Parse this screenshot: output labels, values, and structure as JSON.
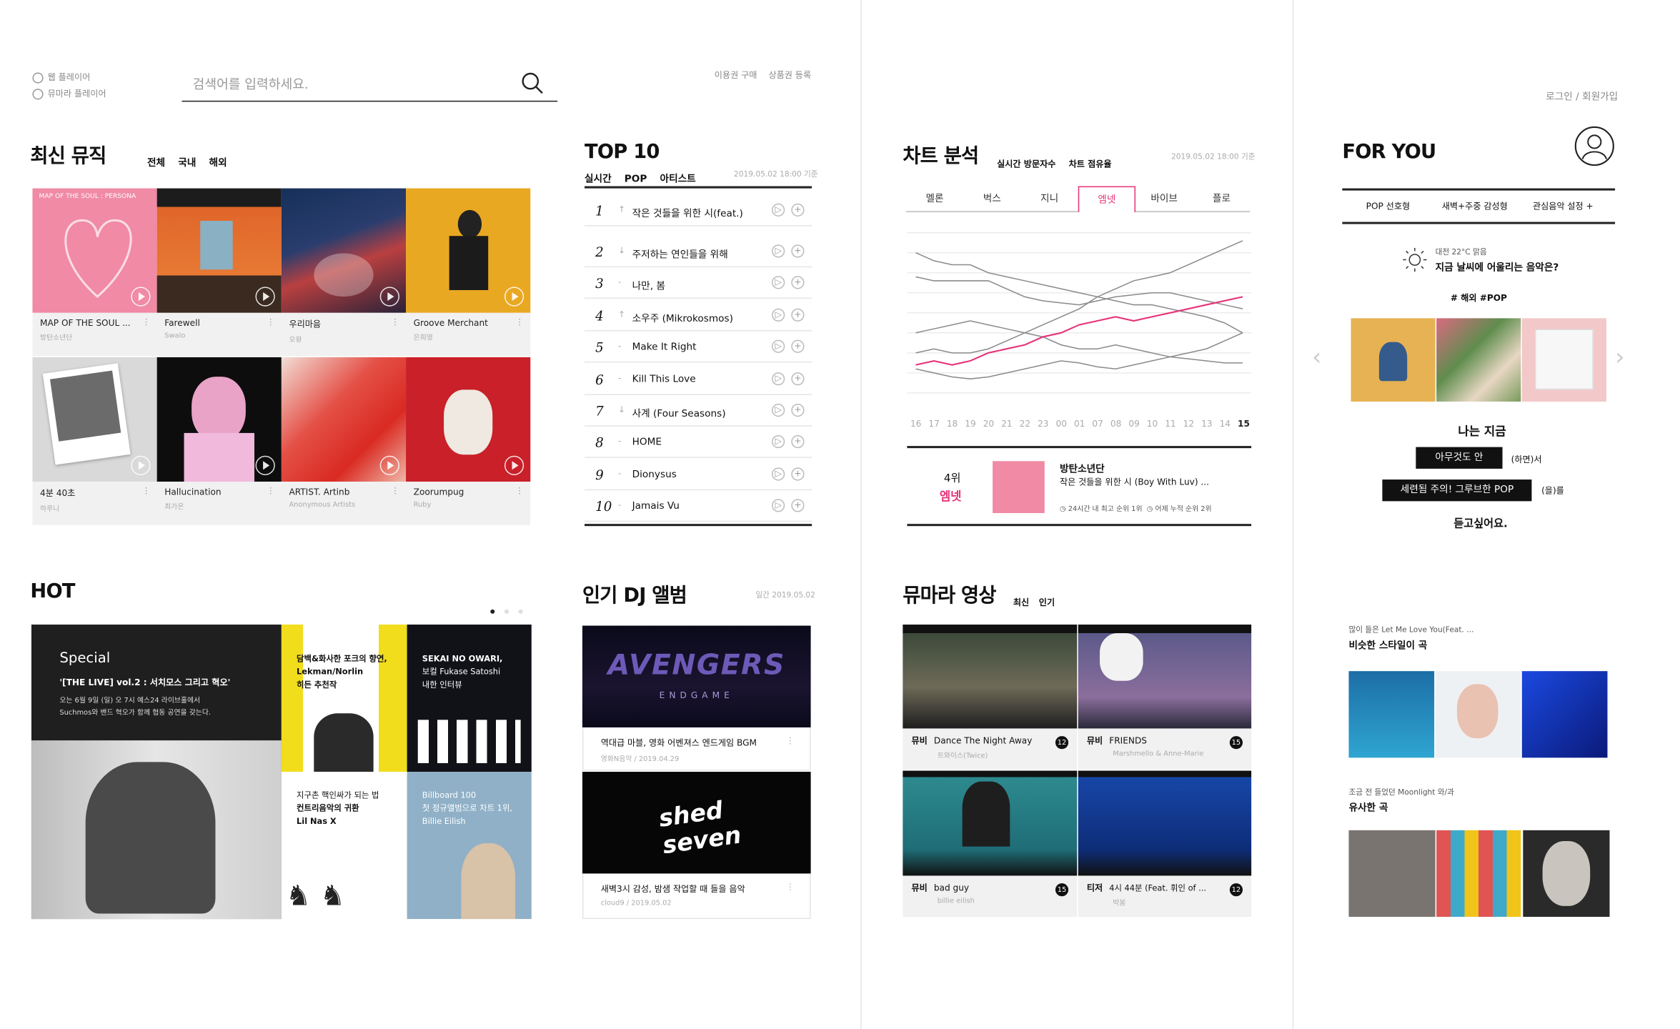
{
  "topbar": {
    "web_player": "웹 플레이어",
    "mumara_player": "뮤마라 플레이어",
    "search_placeholder": "검색어를 입력하세요.",
    "buy_pass": "이용권 구매",
    "gift_card": "상품권 등록",
    "login": "로그인 / 회원가입"
  },
  "latest": {
    "title": "최신 뮤직",
    "tabs": [
      "전체",
      "국내",
      "해외"
    ],
    "albums": [
      {
        "title": "MAP OF THE SOUL ...",
        "artist": "방탄소년단",
        "cover_text": "MAP OF THE SOUL : PERSONA"
      },
      {
        "title": "Farewell",
        "artist": "Swalo"
      },
      {
        "title": "우리마음",
        "artist": "오왕"
      },
      {
        "title": "Groove Merchant",
        "artist": "은희영"
      },
      {
        "title": "4분 40초",
        "artist": "하루니"
      },
      {
        "title": "Hallucination",
        "artist": "최가온"
      },
      {
        "title": "ARTIST. Artinb",
        "artist": "Anonymous Artists"
      },
      {
        "title": "Zoorumpug",
        "artist": "Ruby"
      }
    ]
  },
  "top10": {
    "title": "TOP 10",
    "tabs": [
      "실시간",
      "POP",
      "아티스트"
    ],
    "date": "2019.05.02 18:00 기준",
    "rows": [
      {
        "rank": "1",
        "arrow": "↑",
        "title": "작은 것들을 위한 시(feat.)"
      },
      {
        "rank": "2",
        "arrow": "↓",
        "title": "주저하는 연인들을 위해"
      },
      {
        "rank": "3",
        "arrow": "-",
        "title": "나만, 봄"
      },
      {
        "rank": "4",
        "arrow": "↑",
        "title": "소우주 (Mikrokosmos)"
      },
      {
        "rank": "5",
        "arrow": "-",
        "title": "Make It Right"
      },
      {
        "rank": "6",
        "arrow": "-",
        "title": "Kill This Love"
      },
      {
        "rank": "7",
        "arrow": "↓",
        "title": "사계 (Four Seasons)"
      },
      {
        "rank": "8",
        "arrow": "-",
        "title": "HOME"
      },
      {
        "rank": "9",
        "arrow": "-",
        "title": "Dionysus"
      },
      {
        "rank": "10",
        "arrow": "-",
        "title": "Jamais Vu"
      }
    ]
  },
  "chart": {
    "title": "차트 분석",
    "tabs": [
      "실시간 방문자수",
      "차트 점유율"
    ],
    "date": "2019.05.02 18:00 기준",
    "services": [
      "멜론",
      "벅스",
      "지니",
      "엠넷",
      "바이브",
      "플로"
    ],
    "active_service": "엠넷",
    "accent": "#e6337a",
    "hours": [
      "16",
      "17",
      "18",
      "19",
      "20",
      "21",
      "22",
      "23",
      "00",
      "01",
      "07",
      "08",
      "09",
      "10",
      "11",
      "12",
      "13",
      "14",
      "15"
    ],
    "summary": {
      "rank": "4위",
      "service": "엠넷",
      "artist": "방탄소년단",
      "song": "작은 것들을 위한 시 (Boy With Luv) ...",
      "best": "24시간 내 최고 순위 1위",
      "yesterday": "어제 누적 순위 2위"
    }
  },
  "chart_data": {
    "type": "line",
    "x": [
      "16",
      "17",
      "18",
      "19",
      "20",
      "21",
      "22",
      "23",
      "00",
      "01",
      "07",
      "08",
      "09",
      "10",
      "11",
      "12",
      "13",
      "14",
      "15"
    ],
    "series": [
      {
        "values": [
          7.0,
          6.6,
          6.4,
          6.4,
          6.0,
          5.8,
          5.6,
          5.4,
          5.2,
          5.0,
          4.8,
          4.6,
          4.4,
          4.4,
          4.2,
          4.0,
          3.8,
          3.5,
          3.0
        ]
      },
      {
        "values": [
          5.8,
          5.6,
          5.6,
          5.6,
          5.6,
          5.2,
          4.8,
          4.6,
          4.5,
          4.4,
          4.6,
          4.8,
          4.9,
          5.0,
          5.0,
          4.8,
          4.6,
          4.4,
          4.2
        ]
      },
      {
        "values": [
          3.0,
          3.2,
          3.4,
          3.6,
          3.4,
          3.2,
          3.0,
          2.8,
          2.4,
          2.2,
          2.2,
          2.4,
          2.2,
          2.0,
          1.8,
          1.7,
          1.6,
          1.5,
          1.5
        ]
      },
      {
        "values": [
          2.0,
          2.2,
          2.0,
          2.0,
          2.2,
          2.6,
          3.0,
          3.4,
          3.8,
          4.2,
          4.8,
          5.2,
          5.6,
          5.8,
          6.0,
          6.4,
          6.8,
          7.2,
          7.6
        ]
      },
      {
        "values": [
          1.4,
          1.6,
          1.4,
          1.6,
          2.0,
          2.2,
          2.4,
          2.8,
          3.0,
          3.4,
          3.6,
          3.8,
          3.6,
          3.8,
          4.0,
          4.2,
          4.4,
          4.6,
          4.8
        ]
      },
      {
        "values": [
          1.2,
          1.0,
          0.8,
          0.7,
          0.8,
          1.0,
          1.2,
          1.4,
          1.6,
          1.5,
          1.3,
          1.2,
          1.4,
          1.6,
          1.8,
          2.0,
          2.2,
          2.6,
          3.0
        ]
      }
    ],
    "ylim": [
      0,
      8
    ]
  },
  "foryou": {
    "title": "FOR YOU",
    "tabs": [
      "POP 선호형",
      "새벽+주중 감성형",
      "관심음악 설정 +"
    ],
    "weather": "대전 22°C 맑음",
    "question": "지금 날씨에 어울리는 음악은?",
    "tags": "# 해외 #POP",
    "now": "나는 지금",
    "opt1": "아무것도 안",
    "opt1_suffix": "(하면)서",
    "opt2": "세련됨 주의! 그루브한 POP",
    "opt2_suffix": "(을)를",
    "end": "듣고싶어요.",
    "similar1_sub": "많이 들은 Let Me Love You(Feat. ...",
    "similar1_title": "비슷한 스타일이 곡",
    "similar2_sub": "조금 전 들었던 Moonlight 와/과",
    "similar2_title": "유사한 곡"
  },
  "hot": {
    "title": "HOT",
    "special": "Special",
    "special_title": "'[THE LIVE] vol.2 : 서치모스 그리고 혁오'",
    "special_desc1": "오는 6월 9일 (일) 오 7시 예스24 라이브홀에서",
    "special_desc2": "Suchmos와 밴드 혁오가 함께 협동 공연을 갖는다.",
    "c1": [
      "담백&화사한 포크의 향연,",
      "Lekman/Norlin",
      "히든 추천작"
    ],
    "c2": [
      "SEKAI NO OWARI,",
      "보컬 Fukase Satoshi",
      "내한 인터뷰"
    ],
    "c3": [
      "지구촌 핵인싸가 되는 법",
      "컨트리음악의 귀환",
      "Lil Nas X"
    ],
    "c4": [
      "Billboard 100",
      "첫 정규앨범으로 차트 1위,",
      "Billie Eilish"
    ]
  },
  "dj": {
    "title": "인기 DJ 앨범",
    "date": "일간 2019.05.02",
    "items": [
      {
        "title": "역대급 마블, 영화 어벤져스 엔드게임 BGM",
        "meta": "영화N음악 / 2019.04.29",
        "logo": "AVENGERS",
        "logo_sub": "ENDGAME"
      },
      {
        "title": "새벽3시 감성, 밤샘 작업할 때 들을 음악",
        "meta": "cloud9 / 2019.05.02",
        "logo": "shed seven"
      }
    ]
  },
  "video": {
    "title": "뮤마라 영상",
    "tabs": [
      "최신",
      "인기"
    ],
    "items": [
      {
        "type": "뮤비",
        "title": "Dance The Night Away",
        "artist": "트와이스(Twice)",
        "age": "12"
      },
      {
        "type": "뮤비",
        "title": "FRIENDS",
        "artist": "Marshmello & Anne-Marie",
        "age": "15"
      },
      {
        "type": "뮤비",
        "title": "bad guy",
        "artist": "billie eilish",
        "age": "15"
      },
      {
        "type": "티저",
        "title": "4시 44분 (Feat. 휘인 of ...",
        "artist": "박봄",
        "age": "12"
      }
    ]
  }
}
